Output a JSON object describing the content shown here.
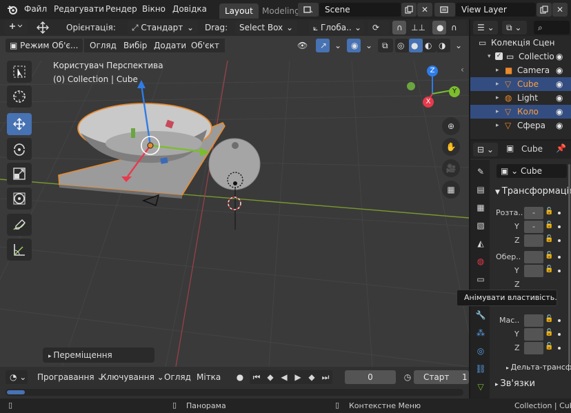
{
  "topbar": {
    "menus": [
      "Файл",
      "Редагувати",
      "Рендер",
      "Вікно",
      "Довідка"
    ],
    "workspace_tabs": [
      "Layout",
      "Modeling"
    ],
    "scene": "Scene",
    "view_layer": "View Layer"
  },
  "viewport_header": {
    "orientation_label": "Орієнтація:",
    "orientation_value": "Стандарт",
    "drag_label": "Drag:",
    "drag_value": "Select Box",
    "transform_space": "Глоба..",
    "mode": "Режим Об'є...",
    "menus": [
      "Огляд",
      "Вибір",
      "Додати",
      "Об'єкт"
    ]
  },
  "viewport": {
    "view_name": "Користувач Перспектива",
    "collection_info": "(0) Collection | Cube",
    "redo_panel": "Переміщення",
    "gizmo_axes": [
      "Z",
      "Y",
      "X"
    ]
  },
  "tools": [
    "select-box",
    "cursor",
    "move",
    "rotate",
    "scale",
    "transform",
    "annotate",
    "measure"
  ],
  "timeline": {
    "playback": "Програвання",
    "keying": "Ключування",
    "view": "Огляд",
    "marker": "Мітка",
    "current_frame": "0",
    "start_label": "Старт",
    "start_value": "1"
  },
  "statusbar": {
    "pan": "Панорама",
    "context_menu": "Контекстне Меню",
    "info": "Collection | Cube"
  },
  "outliner": {
    "rows": [
      {
        "label": "Колекція Сцени",
        "icon": "scene-collection-icon",
        "indent": 0,
        "selected": false
      },
      {
        "label": "Collection",
        "icon": "collection-icon",
        "indent": 1,
        "selected": false
      },
      {
        "label": "Camera",
        "icon": "camera-icon",
        "indent": 2,
        "selected": false
      },
      {
        "label": "Cube",
        "icon": "mesh-icon",
        "indent": 2,
        "selected": true
      },
      {
        "label": "Light",
        "icon": "light-icon",
        "indent": 2,
        "selected": false
      },
      {
        "label": "Коло",
        "icon": "mesh-icon",
        "indent": 2,
        "selected": true
      },
      {
        "label": "Сфера",
        "icon": "mesh-icon",
        "indent": 2,
        "selected": false
      }
    ]
  },
  "properties": {
    "object_name": "Cube",
    "data_name": "Cube",
    "transform_header": "Трансформація",
    "scale_label": "Розта..",
    "rotation_label": "Обер..",
    "mass_label": "Мас..",
    "axis_y": "Y",
    "axis_z": "Z",
    "field_dash": "-",
    "delta_header": "Дельта-трансформація",
    "constraints_header": "Зв'язки"
  },
  "tooltip": "Анімувати властивість.",
  "colors": {
    "accent": "#4772b3",
    "selection_outline": "#e88a2e",
    "axis_x": "#e8394c",
    "axis_y": "#7cbd2e",
    "axis_z": "#2e7ce8"
  }
}
